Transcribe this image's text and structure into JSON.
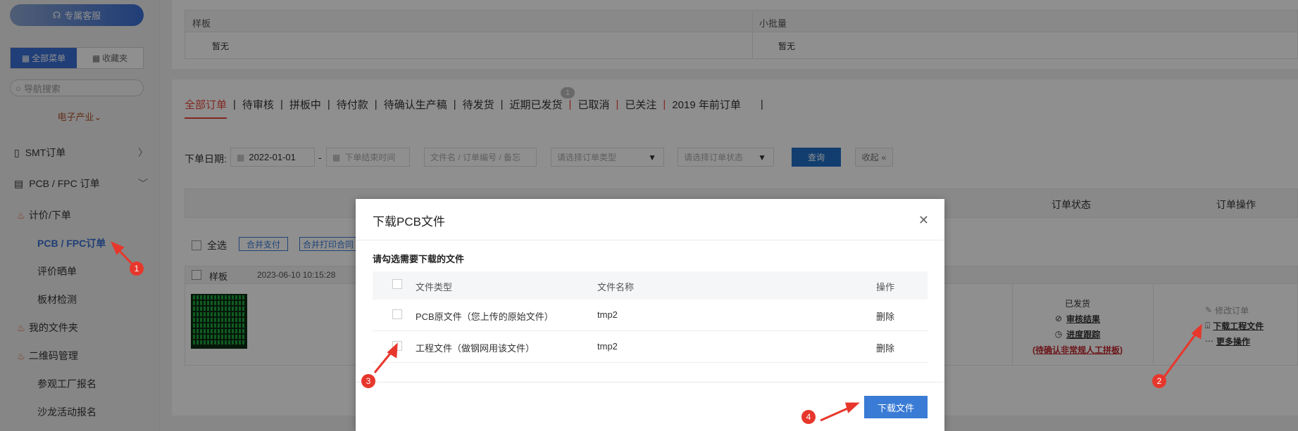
{
  "sidebar": {
    "service_button": "专属客服",
    "tabs": [
      {
        "label": "全部菜单"
      },
      {
        "label": "收藏夹"
      }
    ],
    "search_placeholder": "导航搜索",
    "industry": "电子产业",
    "nav": [
      {
        "label": "SMT订单"
      },
      {
        "label": "PCB / FPC 订单"
      }
    ],
    "sub_items": [
      "计价/下单",
      "PCB / FPC订单",
      "评价晒单",
      "板材检测",
      "我的文件夹",
      "二维码管理",
      "参观工厂报名",
      "沙龙活动报名"
    ]
  },
  "top_table": {
    "col1_header": "样板",
    "col2_header": "小批量",
    "col1_value": "暂无",
    "col2_value": "暂无"
  },
  "order_tabs": {
    "items": [
      "全部订单",
      "待审核",
      "拼板中",
      "待付款",
      "待确认生产稿",
      "待发货",
      "近期已发货",
      "已取消",
      "已关注",
      "2019 年前订单"
    ],
    "badge": "1"
  },
  "filter": {
    "label": "下单日期:",
    "start_date": "2022-01-01",
    "dash": "-",
    "end_placeholder": "下单结束时间",
    "keyword_placeholder": "文件名 / 订单编号 / 备忘",
    "type_placeholder": "请选择订单类型",
    "status_placeholder": "请选择订单状态",
    "query_button": "查询",
    "collapse_button": "收起"
  },
  "table_header": {
    "status": "订单状态",
    "ops": "订单操作"
  },
  "bulk": {
    "select_all": "全选",
    "merge_pay": "合并支付",
    "merge_print": "合并打印合同"
  },
  "order": {
    "type": "样板",
    "datetime": "2023-06-10 10:15:28",
    "status_text": "已发货",
    "review_link": "审核结果",
    "progress_link": "进度跟踪",
    "warn_text": "(待确认非常规人工拼板)",
    "edit_order": "修改订单",
    "download_files": "下载工程文件",
    "more_ops": "更多操作"
  },
  "modal": {
    "title": "下载PCB文件",
    "instruction": "请勾选需要下载的文件",
    "headers": {
      "type": "文件类型",
      "name": "文件名称",
      "op": "操作"
    },
    "rows": [
      {
        "type": "PCB原文件（您上传的原始文件）",
        "name": "tmp2",
        "op": "删除"
      },
      {
        "type": "工程文件（做钢网用该文件）",
        "name": "tmp2",
        "op": "删除"
      }
    ],
    "download_button": "下载文件"
  },
  "annotations": [
    "1",
    "2",
    "3",
    "4"
  ],
  "colors": {
    "accent": "#3a7bd5",
    "active_tab": "#e8473b",
    "annotation": "#e7372c"
  }
}
